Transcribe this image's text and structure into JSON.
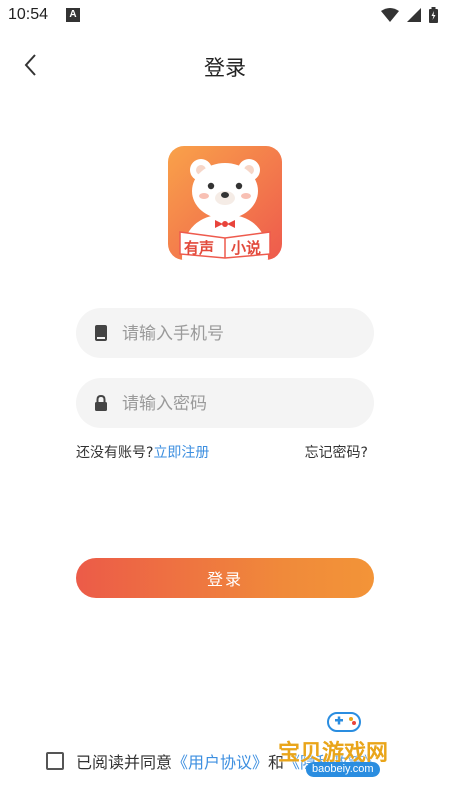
{
  "status_bar": {
    "time": "10:54"
  },
  "header": {
    "title": "登录"
  },
  "logo": {
    "tag_left": "有声",
    "tag_right": "小说"
  },
  "form": {
    "phone_placeholder": "请输入手机号",
    "password_placeholder": "请输入密码",
    "no_account_text": "还没有账号?",
    "register_link": "立即注册",
    "forgot_link": "忘记密码?",
    "login_button": "登录"
  },
  "agreement": {
    "checked": false,
    "prefix": "已阅读并同意",
    "user_agreement": "《用户协议》",
    "and": "和",
    "privacy_policy": "《隐私政策》"
  },
  "watermark": {
    "title": "宝贝游戏网",
    "url": "baobeiy.com"
  },
  "colors": {
    "accent_blue": "#3d8fe0",
    "button_start": "#ec5b48",
    "button_end": "#f39438"
  }
}
